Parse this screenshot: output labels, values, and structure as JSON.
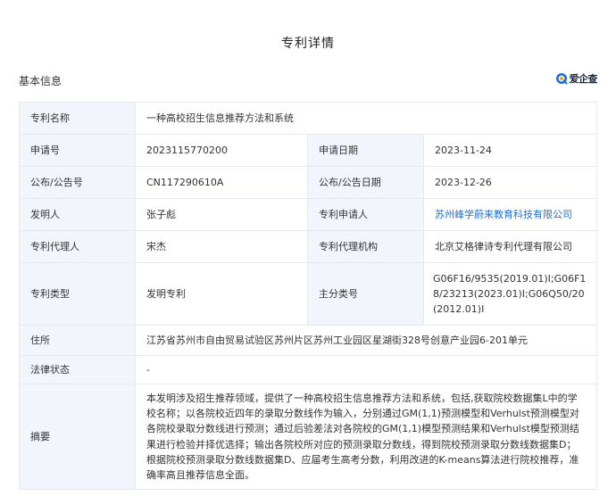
{
  "page_title": "专利详情",
  "section_title": "基本信息",
  "brand": {
    "name": "爱企查",
    "icon": "qichacha-logo-icon",
    "accent": "#1f6fd1"
  },
  "fields": {
    "patent_name": {
      "label": "专利名称",
      "value": "一种高校招生信息推荐方法和系统"
    },
    "application_no": {
      "label": "申请号",
      "value": "2023115770200"
    },
    "application_date": {
      "label": "申请日期",
      "value": "2023-11-24"
    },
    "publication_no": {
      "label": "公布/公告号",
      "value": "CN117290610A"
    },
    "publication_date": {
      "label": "公布/公告日期",
      "value": "2023-12-26"
    },
    "inventor": {
      "label": "发明人",
      "value": "张子彪"
    },
    "applicant": {
      "label": "专利申请人",
      "value": "苏州峰学蔚来教育科技有限公司"
    },
    "agent": {
      "label": "专利代理人",
      "value": "宋杰"
    },
    "agency": {
      "label": "专利代理机构",
      "value": "北京艾格律诗专利代理有限公司"
    },
    "patent_type": {
      "label": "专利类型",
      "value": "发明专利"
    },
    "main_class": {
      "label": "主分类号",
      "value": "G06F16/9535(2019.01)I;G06F18/23213(2023.01)I;G06Q50/20(2012.01)I"
    },
    "address": {
      "label": "住所",
      "value": "江苏省苏州市自由贸易试验区苏州片区苏州工业园区星湖街328号创意产业园6-201单元"
    },
    "legal_status": {
      "label": "法律状态",
      "value": "-"
    },
    "abstract": {
      "label": "摘要",
      "value": "本发明涉及招生推荐领域，提供了一种高校招生信息推荐方法和系统，包括,获取院校数据集L中的学校名称；以各院校近四年的录取分数线作为输入，分别通过GM(1,1)预测模型和Verhulst预测模型对各院校录取分数线进行预测；通过后验差法对各院校的GM(1,1)模型预测结果和Verhulst模型预测结果进行检验并择优选择；输出各院校所对应的预测录取分数线，得到院校预测录取分数线数据集D；根据院校预测录取分数线数据集D、应届考生高考分数，利用改进的K-means算法进行院校推荐，准确率高且推荐信息全面。"
    }
  }
}
